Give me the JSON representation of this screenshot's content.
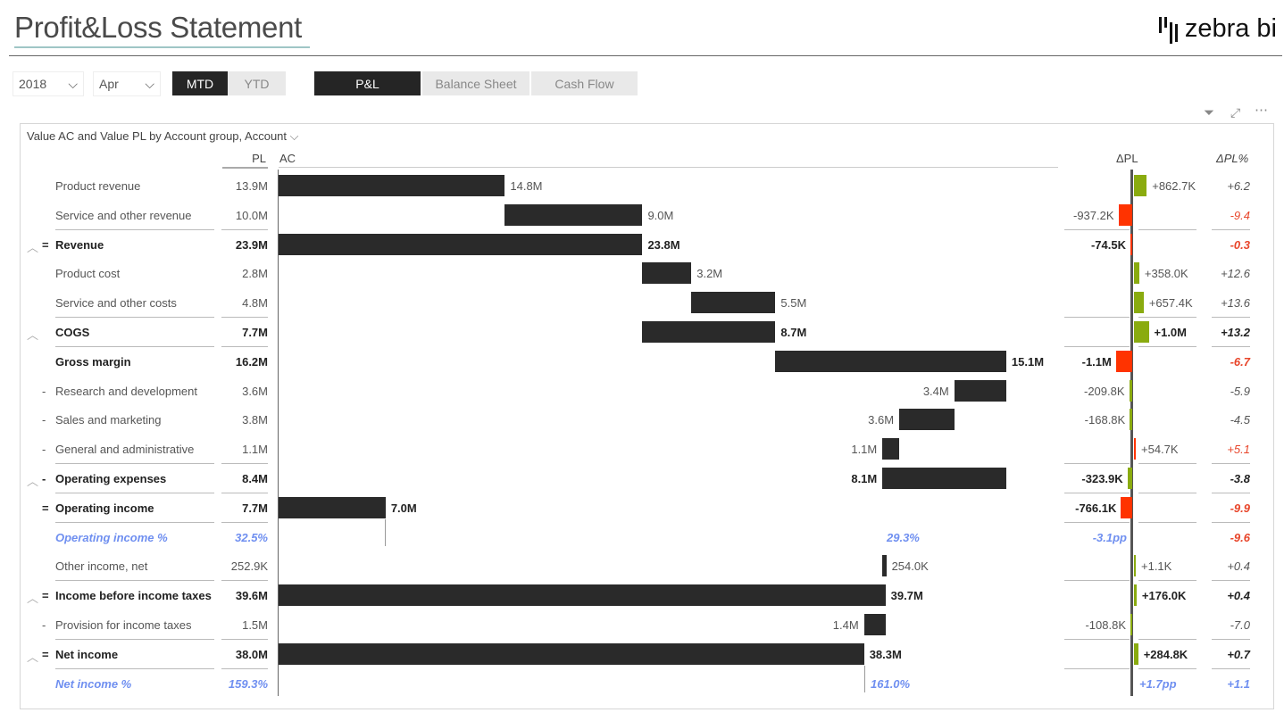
{
  "header": {
    "title": "Profit&Loss Statement",
    "logo_text": "zebra bi"
  },
  "slicers": {
    "year": "2018",
    "month": "Apr"
  },
  "period_toggle": [
    {
      "label": "MTD",
      "active": true
    },
    {
      "label": "YTD",
      "active": false
    }
  ],
  "report_toggle": [
    {
      "label": "P&L",
      "active": true
    },
    {
      "label": "Balance Sheet",
      "active": false
    },
    {
      "label": "Cash Flow",
      "active": false
    }
  ],
  "visual": {
    "title": "Value AC and Value PL by Account group, Account",
    "icons": [
      "filter-icon",
      "focus-mode-icon",
      "more-options-icon"
    ],
    "columns": {
      "pl": "PL",
      "ac": "AC",
      "dpl": "ΔPL",
      "dplpct": "ΔPL%"
    }
  },
  "colors": {
    "positive": "#8aab0f",
    "negative": "#ff3300",
    "bar": "#2a2a2a",
    "percent_text": "#6f8ff0",
    "negative_text": "#e8452a"
  },
  "rows": [
    {
      "prefix": "",
      "expand": false,
      "label": "Product revenue",
      "style": "normal",
      "pl": "13.9M",
      "ac": "14.8M",
      "from": 0,
      "value": 14.8,
      "dpl": "+862.7K",
      "dpl_k": 862.7,
      "dpl_color": "positive",
      "dplpct": "+6.2",
      "pct_color": "normal"
    },
    {
      "prefix": "",
      "expand": false,
      "label": "Service and other revenue",
      "style": "normal",
      "pl": "10.0M",
      "ac": "9.0M",
      "from": 14.8,
      "value": 9.0,
      "dpl": "-937.2K",
      "dpl_k": -937.2,
      "dpl_color": "negative",
      "dplpct": "-9.4",
      "pct_color": "negative",
      "sep": true
    },
    {
      "prefix": "=",
      "expand": true,
      "label": "Revenue",
      "style": "bold",
      "pl": "23.9M",
      "ac": "23.8M",
      "from": 0,
      "value": 23.8,
      "dpl": "-74.5K",
      "dpl_k": -74.5,
      "dpl_color": "negative",
      "dplpct": "-0.3",
      "pct_color": "negative"
    },
    {
      "prefix": "",
      "expand": false,
      "label": "Product cost",
      "style": "normal",
      "pl": "2.8M",
      "ac": "3.2M",
      "from": 23.8,
      "value": 3.2,
      "dpl": "+358.0K",
      "dpl_k": 358.0,
      "dpl_color": "positive",
      "dplpct": "+12.6",
      "pct_color": "normal"
    },
    {
      "prefix": "",
      "expand": false,
      "label": "Service and other costs",
      "style": "normal",
      "pl": "4.8M",
      "ac": "5.5M",
      "from": 27.0,
      "value": 5.5,
      "dpl": "+657.4K",
      "dpl_k": 657.4,
      "dpl_color": "positive",
      "dplpct": "+13.6",
      "pct_color": "normal",
      "sep": true
    },
    {
      "prefix": "",
      "expand": true,
      "label": "COGS",
      "style": "bold",
      "pl": "7.7M",
      "ac": "8.7M",
      "from": 23.8,
      "value": 8.7,
      "dpl": "+1.0M",
      "dpl_k": 1000,
      "dpl_color": "positive",
      "dplpct": "+13.2",
      "pct_color": "normal",
      "sep": true
    },
    {
      "prefix": "",
      "expand": false,
      "label": "Gross margin",
      "style": "bold",
      "pl": "16.2M",
      "ac": "15.1M",
      "from": 32.5,
      "value": 15.1,
      "dpl": "-1.1M",
      "dpl_k": -1100,
      "dpl_color": "negative",
      "dplpct": "-6.7",
      "pct_color": "negative"
    },
    {
      "prefix": "-",
      "expand": false,
      "label": "Research and development",
      "style": "normal",
      "pl": "3.6M",
      "ac": "3.4M",
      "from": 44.2,
      "value": 3.4,
      "ac_left": true,
      "dpl": "-209.8K",
      "dpl_k": -209.8,
      "dpl_color": "positive",
      "dplpct": "-5.9",
      "pct_color": "normal"
    },
    {
      "prefix": "-",
      "expand": false,
      "label": "Sales and marketing",
      "style": "normal",
      "pl": "3.8M",
      "ac": "3.6M",
      "from": 40.6,
      "value": 3.6,
      "ac_left": true,
      "dpl": "-168.8K",
      "dpl_k": -168.8,
      "dpl_color": "positive",
      "dplpct": "-4.5",
      "pct_color": "normal"
    },
    {
      "prefix": "-",
      "expand": false,
      "label": "General and administrative",
      "style": "normal",
      "pl": "1.1M",
      "ac": "1.1M",
      "from": 39.5,
      "value": 1.1,
      "ac_left": true,
      "dpl": "+54.7K",
      "dpl_k": 54.7,
      "dpl_color": "negative",
      "dplpct": "+5.1",
      "pct_color": "negative",
      "sep": true
    },
    {
      "prefix": "-",
      "expand": true,
      "label": "Operating expenses",
      "style": "bold",
      "pl": "8.4M",
      "ac": "8.1M",
      "from": 39.5,
      "value": 8.1,
      "ac_left": true,
      "dpl": "-323.9K",
      "dpl_k": -323.9,
      "dpl_color": "positive",
      "dplpct": "-3.8",
      "pct_color": "normal",
      "sep": true
    },
    {
      "prefix": "=",
      "expand": false,
      "label": "Operating income",
      "style": "bold",
      "pl": "7.7M",
      "ac": "7.0M",
      "from": 0,
      "value": 7.0,
      "dpl": "-766.1K",
      "dpl_k": -766.1,
      "dpl_color": "negative",
      "dplpct": "-9.9",
      "pct_color": "negative",
      "sep": true
    },
    {
      "prefix": "",
      "expand": false,
      "label": "Operating income %",
      "style": "pct",
      "pl": "32.5%",
      "ac": "29.3%",
      "dpl": "-3.1pp",
      "dplpct": "-9.6",
      "pct_color": "negative"
    },
    {
      "prefix": "",
      "expand": false,
      "label": "Other income, net",
      "style": "normal",
      "pl": "252.9K",
      "ac": "254.0K",
      "from": 39.5,
      "value": 0.254,
      "dpl": "+1.1K",
      "dpl_k": 1.1,
      "dpl_color": "positive",
      "dplpct": "+0.4",
      "pct_color": "normal",
      "sep": true
    },
    {
      "prefix": "=",
      "expand": true,
      "label": "Income before income taxes",
      "style": "bold",
      "pl": "39.6M",
      "ac": "39.7M",
      "from": 0,
      "value": 39.7,
      "dpl": "+176.0K",
      "dpl_k": 176.0,
      "dpl_color": "positive",
      "dplpct": "+0.4",
      "pct_color": "normal"
    },
    {
      "prefix": "-",
      "expand": false,
      "label": "Provision for income taxes",
      "style": "normal",
      "pl": "1.5M",
      "ac": "1.4M",
      "from": 38.3,
      "value": 1.4,
      "ac_left": true,
      "dpl": "-108.8K",
      "dpl_k": -108.8,
      "dpl_color": "positive",
      "dplpct": "-7.0",
      "pct_color": "normal",
      "sep": true
    },
    {
      "prefix": "=",
      "expand": true,
      "label": "Net income",
      "style": "bold",
      "pl": "38.0M",
      "ac": "38.3M",
      "from": 0,
      "value": 38.3,
      "dpl": "+284.8K",
      "dpl_k": 284.8,
      "dpl_color": "positive",
      "dplpct": "+0.7",
      "pct_color": "normal",
      "sep": true
    },
    {
      "prefix": "",
      "expand": false,
      "label": "Net income %",
      "style": "pct",
      "pl": "159.3%",
      "ac": "161.0%",
      "dpl": "+1.7pp",
      "dplpct": "+1.1",
      "pct_color": "percent"
    }
  ]
}
